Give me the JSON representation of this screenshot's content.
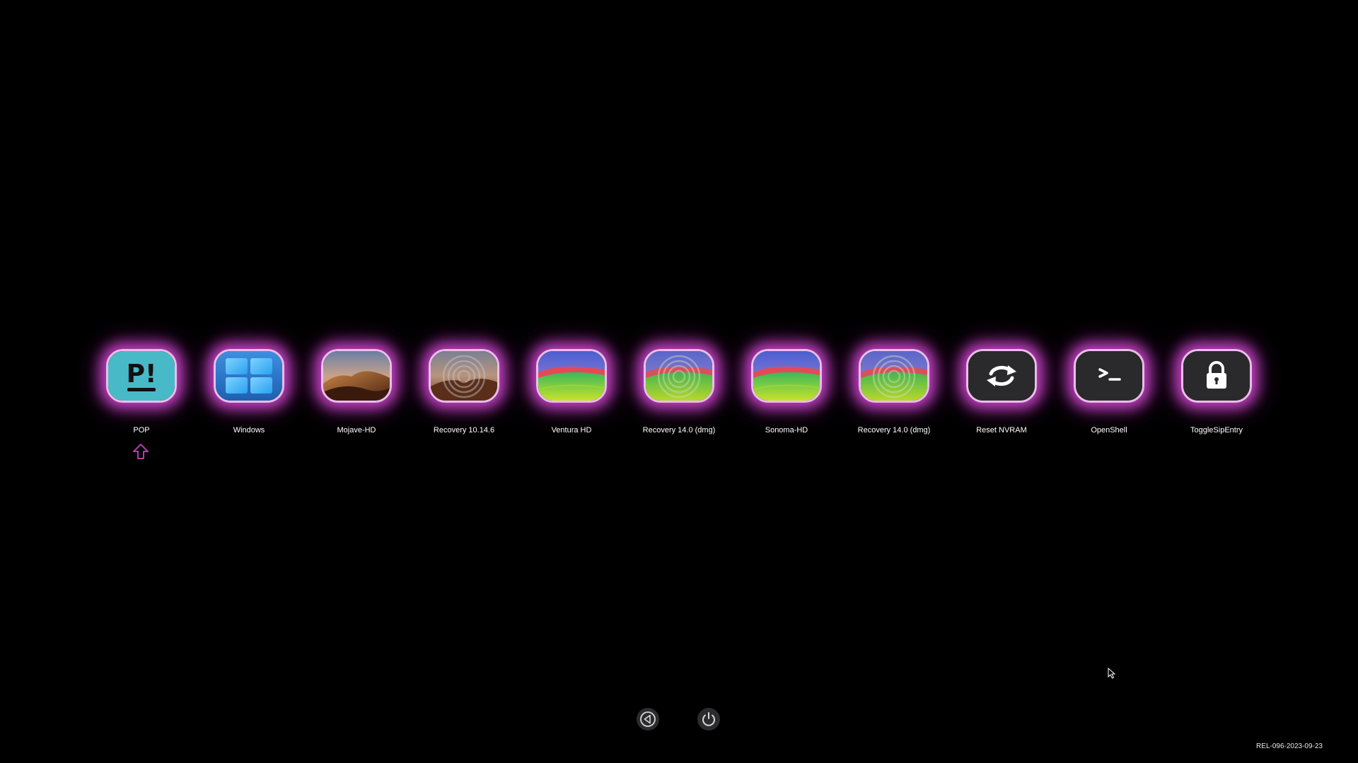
{
  "entries": [
    {
      "label": "POP",
      "icon": "pop-os-icon"
    },
    {
      "label": "Windows",
      "icon": "windows-icon"
    },
    {
      "label": "Mojave-HD",
      "icon": "mojave-dunes-icon"
    },
    {
      "label": "Recovery 10.14.6",
      "icon": "mojave-recovery-icon"
    },
    {
      "label": "Ventura HD",
      "icon": "ventura-hills-icon"
    },
    {
      "label": "Recovery 14.0 (dmg)",
      "icon": "sonoma-recovery-icon"
    },
    {
      "label": "Sonoma-HD",
      "icon": "sonoma-hills-icon"
    },
    {
      "label": "Recovery 14.0 (dmg)",
      "icon": "sonoma-recovery-icon"
    },
    {
      "label": "Reset NVRAM",
      "icon": "reset-arrows-icon"
    },
    {
      "label": "OpenShell",
      "icon": "terminal-icon"
    },
    {
      "label": "ToggleSipEntry",
      "icon": "lock-icon"
    }
  ],
  "selected_index": 0,
  "controls": {
    "left": {
      "icon": "restart-icon"
    },
    "right": {
      "icon": "power-icon"
    }
  },
  "version": "REL-096-2023-09-23",
  "colors": {
    "background": "#000000",
    "glow": "#d64ad6",
    "selector": "#b03cb0"
  }
}
